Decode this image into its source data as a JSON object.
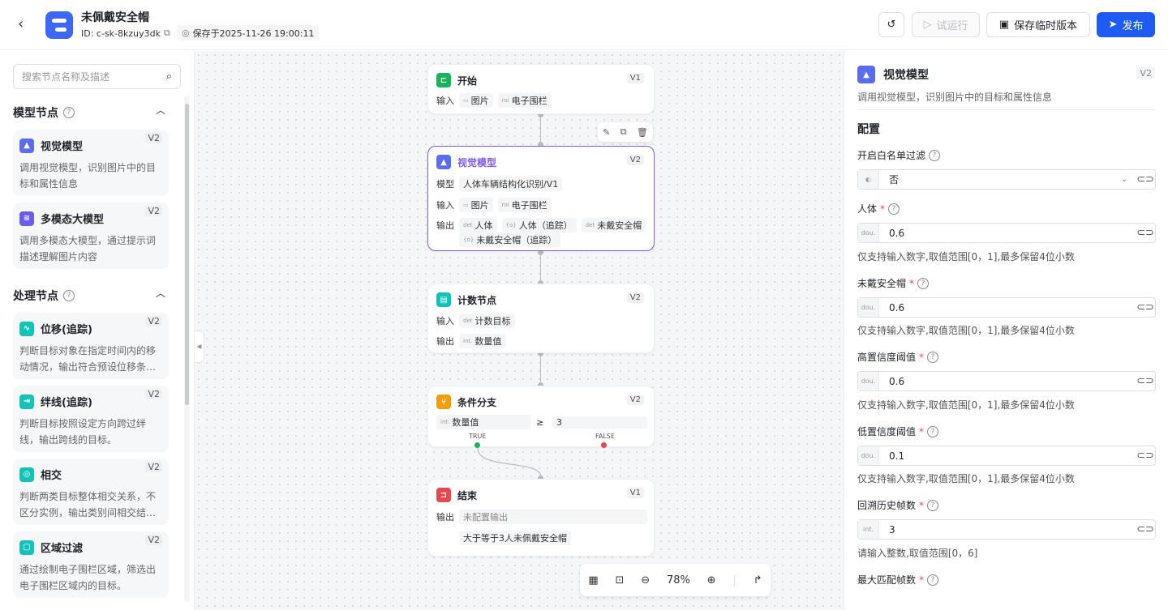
{
  "header": {
    "app_title": "未佩戴安全帽",
    "id_text": "ID: c-sk-8kzuy3dk",
    "save_text": "保存于2025-11-26 19:00:11",
    "test_run_label": "试运行",
    "save_version_label": "保存临时版本",
    "publish_label": "发布"
  },
  "sidebar": {
    "search_placeholder": "搜索节点名称及描述",
    "sections": [
      {
        "title": "模型节点"
      },
      {
        "title": "处理节点"
      }
    ],
    "cards": [
      {
        "name": "视觉模型",
        "version": "V2",
        "desc": "调用视觉模型，识别图片中的目标和属性信息",
        "color": "#5b6cf0"
      },
      {
        "name": "多模态大模型",
        "version": "V2",
        "desc": "调用多模态大模型，通过提示词描述理解图片内容",
        "color": "#6a5cf0"
      },
      {
        "name": "位移(追踪)",
        "version": "V2",
        "desc": "判断目标对象在指定时间内的移动情况，输出符合预设位移条…",
        "color": "#14c3b8"
      },
      {
        "name": "绊线(追踪)",
        "version": "V2",
        "desc": "判断目标按照设定方向跨过绊线，输出跨线的目标。",
        "color": "#14c3b8"
      },
      {
        "name": "相交",
        "version": "V2",
        "desc": "判断两类目标整体相交关系，不区分实例，输出类别间相交结…",
        "color": "#14c3b8"
      },
      {
        "name": "区域过滤",
        "version": "V2",
        "desc": "通过绘制电子围栏区域，筛选出电子围栏区域内的目标。",
        "color": "#14c3b8"
      }
    ]
  },
  "canvas": {
    "start": {
      "title": "开始",
      "version": "V1",
      "input_label": "输入",
      "inputs": [
        "图片",
        "电子围栏"
      ]
    },
    "vision": {
      "title": "视觉模型",
      "version": "V2",
      "model_label": "模型",
      "model": "人体车辆结构化识别/V1",
      "input_label": "输入",
      "inputs": [
        "图片",
        "电子围栏"
      ],
      "output_label": "输出",
      "outputs": [
        "人体",
        "人体（追踪）",
        "未戴安全帽",
        "未戴安全帽（追踪）"
      ]
    },
    "counter": {
      "title": "计数节点",
      "version": "V2",
      "input_label": "输入",
      "input": "计数目标",
      "output_label": "输出",
      "output": "数量值"
    },
    "branch": {
      "title": "条件分支",
      "version": "V2",
      "field": "数量值",
      "op": "≥",
      "value": "3",
      "true_label": "TRUE",
      "false_label": "FALSE"
    },
    "end": {
      "title": "结束",
      "version": "V1",
      "output_label": "输出",
      "output_placeholder": "未配置输出",
      "message": "大于等于3人未佩戴安全帽"
    },
    "zoom": "78%"
  },
  "panel": {
    "title": "视觉模型",
    "version": "V2",
    "desc": "调用视觉模型，识别图片中的目标和属性信息",
    "section": "配置",
    "whitelist": {
      "label": "开启白名单过滤",
      "value": "否"
    },
    "fields": [
      {
        "label": "人体",
        "prefix": "dou.",
        "value": "0.6",
        "hint": "仅支持输入数字,取值范围[0，1],最多保留4位小数"
      },
      {
        "label": "未戴安全帽",
        "prefix": "dou.",
        "value": "0.6",
        "hint": "仅支持输入数字,取值范围[0，1],最多保留4位小数"
      },
      {
        "label": "高置信度阈值",
        "prefix": "dou.",
        "value": "0.6",
        "hint": "仅支持输入数字,取值范围[0，1],最多保留4位小数"
      },
      {
        "label": "低置信度阈值",
        "prefix": "dou.",
        "value": "0.1",
        "hint": "仅支持输入数字,取值范围[0，1],最多保留4位小数"
      },
      {
        "label": "回溯历史帧数",
        "prefix": "int.",
        "value": "3",
        "hint": "请输入整数,取值范围[0，6]"
      }
    ],
    "last_label": "最大匹配帧数"
  }
}
